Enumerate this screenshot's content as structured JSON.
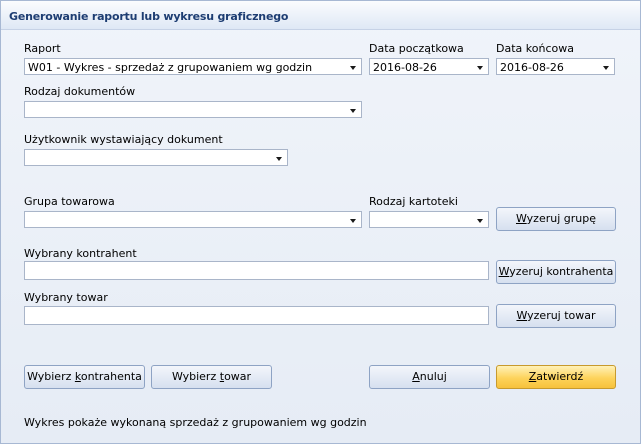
{
  "window": {
    "title": "Generowanie raportu lub wykresu graficznego"
  },
  "form": {
    "report": {
      "label": "Raport",
      "value": "W01 - Wykres - sprzedaż z grupowaniem wg godzin"
    },
    "date_from": {
      "label": "Data początkowa",
      "value": "2016-08-26"
    },
    "date_to": {
      "label": "Data końcowa",
      "value": "2016-08-26"
    },
    "doc_type": {
      "label": "Rodzaj dokumentów",
      "value": ""
    },
    "user": {
      "label": "Użytkownik wystawiający dokument",
      "value": ""
    },
    "product_group": {
      "label": "Grupa towarowa",
      "value": ""
    },
    "card_type": {
      "label": "Rodzaj kartoteki",
      "value": ""
    },
    "contractor": {
      "label": "Wybrany kontrahent",
      "value": ""
    },
    "product": {
      "label": "Wybrany towar",
      "value": ""
    }
  },
  "buttons": {
    "clear_group": {
      "pre": "",
      "mnemonic": "W",
      "post": "yzeruj grupę"
    },
    "clear_contractor": {
      "pre": "",
      "mnemonic": "W",
      "post": "yzeruj kontrahenta"
    },
    "clear_product": {
      "pre": "",
      "mnemonic": "W",
      "post": "yzeruj towar"
    },
    "choose_contractor": {
      "pre": "Wybierz ",
      "mnemonic": "k",
      "post": "ontrahenta"
    },
    "choose_product": {
      "pre": "Wybierz ",
      "mnemonic": "t",
      "post": "owar"
    },
    "cancel": {
      "pre": "",
      "mnemonic": "A",
      "post": "nuluj"
    },
    "confirm": {
      "pre": "",
      "mnemonic": "Z",
      "post": "atwierdź"
    }
  },
  "status": {
    "description": "Wykres pokaże wykonaną sprzedaż z grupowaniem wg godzin"
  }
}
